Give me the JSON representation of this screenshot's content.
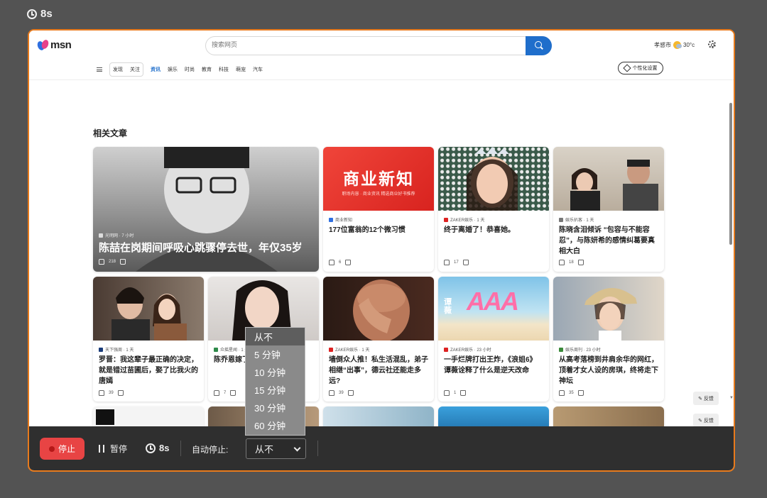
{
  "top_timer": "8s",
  "browser": {
    "logo_text": "msn",
    "search_placeholder": "搜索网页",
    "weather_city": "孝感市",
    "weather_temp": "30°c",
    "nav": {
      "pill_items": [
        "发现",
        "关注"
      ],
      "items": [
        "资讯",
        "娱乐",
        "时尚",
        "教育",
        "科技",
        "萌宠",
        "汽车"
      ],
      "active": "资讯"
    },
    "personalize_label": "个性化设置",
    "section_title": "相关文章",
    "feedback_label": "反馈",
    "accent_color": "#1f6ecb",
    "hero": {
      "source": "光明网 · 7 小时",
      "title": "陈喆在岗期间呼吸心跳骤停去世，年仅35岁",
      "likes": "218"
    },
    "cards_row1": [
      {
        "source": "商业新知",
        "title": "177位富翁的12个微习惯",
        "likes": "6",
        "thumb_text": "商业新知",
        "thumb_sub": "职场内容 · 商业资讯 精选商业好书推荐"
      },
      {
        "source": "ZAKER娱乐 · 1 天",
        "title": "终于离婚了！恭喜她。",
        "likes": "17"
      },
      {
        "source": "娱乐扒客 · 1 天",
        "title": "陈晓含泪倾诉 “包容与不能容忍”，与陈妍希的感情纠葛要真相大白",
        "likes": "18"
      }
    ],
    "cards_row2": [
      {
        "source": "天下强周 · 1 天",
        "title": "罗晋：我这辈子最正确的决定，就是错过苗圃后，娶了比我火的唐嫣",
        "likes": "39"
      },
      {
        "source": "众摇星闻 · 1 天",
        "title": "陈乔恩嫁了，粉丝",
        "likes": "7"
      },
      {
        "source": "ZAKER娱乐 · 1 天",
        "title": "墙倒众人推！私生活混乱，弟子相继“出事”，德云社还能走多远?",
        "likes": "39"
      },
      {
        "source": "ZAKER娱乐 · 23 小时",
        "title": "一手烂牌打出王炸，《浪姐6》谭薇诠释了什么是逆天改命",
        "likes": "1",
        "thumb_text": "AAA",
        "thumb_side": "谭薇"
      },
      {
        "source": "娱乐周刊 · 23 小时",
        "title": "从高考落榜到井肩余华的网红，顶着才女人设的房琪，终将走下神坛",
        "likes": "35"
      }
    ]
  },
  "recorder": {
    "stop_label": "停止",
    "pause_label": "暂停",
    "timer": "8s",
    "auto_stop_label": "自动停止:",
    "auto_stop_value": "从不",
    "options": [
      "从不",
      "5 分钟",
      "10 分钟",
      "15 分钟",
      "30 分钟",
      "60 分钟"
    ],
    "selected_option": "从不",
    "stop_color": "#e84444",
    "frame_color": "#e87a1c"
  }
}
